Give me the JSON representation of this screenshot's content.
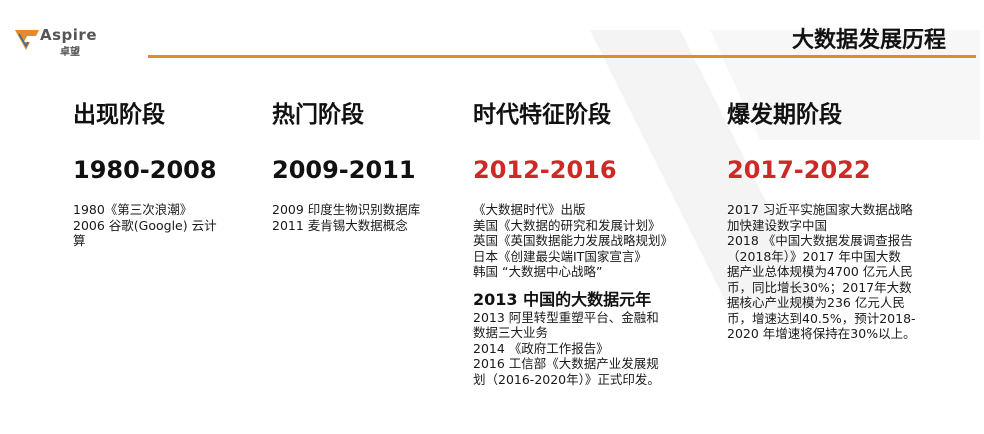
{
  "header": {
    "logo_en": "Aspire",
    "logo_cn": "卓望",
    "title": "大数据发展历程",
    "accent_color": "#e5892a"
  },
  "stages": [
    {
      "name": "出现阶段",
      "years": "1980-2008",
      "years_color": "#111111",
      "items": [
        "1980《第三次浪潮》",
        "2006 谷歌(Google) 云计",
        "算"
      ]
    },
    {
      "name": "热门阶段",
      "years": "2009-2011",
      "years_color": "#111111",
      "items": [
        "2009 印度生物识别数据库",
        "2011 麦肯锡大数据概念"
      ]
    },
    {
      "name": "时代特征阶段",
      "years": "2012-2016",
      "years_color": "#cc2a27",
      "items": [
        "《大数据时代》出版",
        "美国《大数据的研究和发展计划》",
        "英国《英国数据能力发展战略规划》",
        "日本《创建最尖端IT国家宣言》",
        "韩国 “大数据中心战略”"
      ],
      "subheading": "2013 中国的大数据元年",
      "subitems": [
        "2013 阿里转型重塑平台、金融和",
        "数据三大业务",
        "2014 《政府工作报告》",
        "2016 工信部《大数据产业发展规",
        "划（2016-2020年）》正式印发。"
      ]
    },
    {
      "name": "爆发期阶段",
      "years": "2017-2022",
      "years_color": "#cc2a27",
      "items": [
        "2017 习近平实施国家大数据战略",
        "加快建设数字中国",
        "2018 《中国大数据发展调查报告",
        "（2018年）》2017 年中国大数",
        "据产业总体规模为4700 亿元人民",
        "币，同比增长30%；2017年大数",
        "据核心产业规模为236 亿元人民",
        "币，增速达到40.5%，预计2018-",
        "2020 年增速将保持在30%以上。"
      ]
    }
  ]
}
